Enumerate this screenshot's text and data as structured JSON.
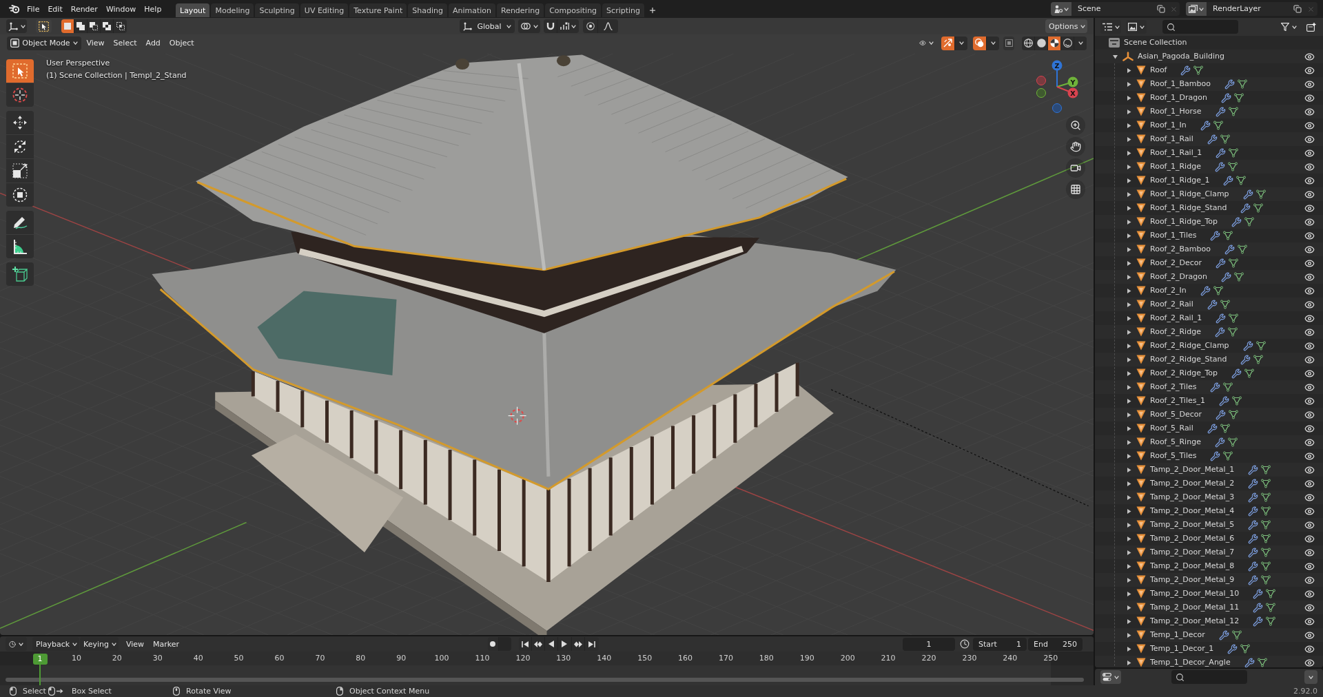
{
  "topbar": {
    "menus": [
      "File",
      "Edit",
      "Render",
      "Window",
      "Help"
    ],
    "workspaces": [
      {
        "label": "Layout",
        "selected": true
      },
      {
        "label": "Modeling",
        "selected": false
      },
      {
        "label": "Sculpting",
        "selected": false
      },
      {
        "label": "UV Editing",
        "selected": false
      },
      {
        "label": "Texture Paint",
        "selected": false
      },
      {
        "label": "Shading",
        "selected": false
      },
      {
        "label": "Animation",
        "selected": false
      },
      {
        "label": "Rendering",
        "selected": false
      },
      {
        "label": "Compositing",
        "selected": false
      },
      {
        "label": "Scripting",
        "selected": false
      }
    ],
    "scene": "Scene",
    "view_layer": "RenderLayer"
  },
  "tool_header": {
    "select_modes": [
      {
        "kind": "set",
        "selected": true
      },
      {
        "kind": "extend",
        "selected": false
      },
      {
        "kind": "subtract",
        "selected": false
      },
      {
        "kind": "difference",
        "selected": false
      },
      {
        "kind": "intersect",
        "selected": false
      }
    ],
    "orientation": "Global",
    "snap": false,
    "proportional_editing": false,
    "options": "Options"
  },
  "view3d_header": {
    "mode": "Object Mode",
    "menus": [
      "View",
      "Select",
      "Add",
      "Object"
    ],
    "gizmos": true,
    "overlays": true,
    "xray": false,
    "shading": [
      {
        "kind": "wireframe",
        "selected": false
      },
      {
        "kind": "solid",
        "selected": false
      },
      {
        "kind": "material",
        "selected": true
      },
      {
        "kind": "rendered",
        "selected": false
      }
    ]
  },
  "toolbar": {
    "groups": [
      {
        "tools": [
          {
            "kind": "select_box",
            "selected": true
          },
          {
            "kind": "cursor",
            "selected": false
          }
        ]
      },
      {
        "tools": [
          {
            "kind": "move",
            "selected": false
          },
          {
            "kind": "rotate",
            "selected": false
          },
          {
            "kind": "scale",
            "selected": false
          },
          {
            "kind": "transform",
            "selected": false
          }
        ]
      },
      {
        "tools": [
          {
            "kind": "annotate",
            "selected": false
          },
          {
            "kind": "measure",
            "selected": false
          }
        ]
      },
      {
        "tools": [
          {
            "kind": "add_cube",
            "selected": false
          }
        ]
      }
    ]
  },
  "viewport": {
    "info": [
      "User Perspective",
      "(1) Scene Collection | Templ_2_Stand"
    ],
    "gizmo_axes": [
      {
        "kind": "z",
        "label": "Z"
      },
      {
        "kind": "y",
        "label": "Y"
      },
      {
        "kind": "x",
        "label": "X"
      }
    ]
  },
  "outliner": {
    "tree": [
      {
        "name": "Scene Collection",
        "kind": "scene_collection",
        "children": [
          {
            "name": "Asian_Pagoda_Building",
            "kind": "empty",
            "expanded": true,
            "visible": true,
            "children": [
              {
                "name": "Roof",
                "kind": "mesh",
                "expanded": false,
                "visible": true
              },
              {
                "name": "Roof_1_Bamboo",
                "kind": "mesh",
                "expanded": false,
                "visible": true
              },
              {
                "name": "Roof_1_Dragon",
                "kind": "mesh",
                "expanded": false,
                "visible": true
              },
              {
                "name": "Roof_1_Horse",
                "kind": "mesh",
                "expanded": false,
                "visible": true
              },
              {
                "name": "Roof_1_In",
                "kind": "mesh",
                "expanded": false,
                "visible": true
              },
              {
                "name": "Roof_1_Rail",
                "kind": "mesh",
                "expanded": false,
                "visible": true
              },
              {
                "name": "Roof_1_Rail_1",
                "kind": "mesh",
                "expanded": false,
                "visible": true
              },
              {
                "name": "Roof_1_Ridge",
                "kind": "mesh",
                "expanded": false,
                "visible": true
              },
              {
                "name": "Roof_1_Ridge_1",
                "kind": "mesh",
                "expanded": false,
                "visible": true
              },
              {
                "name": "Roof_1_Ridge_Clamp",
                "kind": "mesh",
                "expanded": false,
                "visible": true
              },
              {
                "name": "Roof_1_Ridge_Stand",
                "kind": "mesh",
                "expanded": false,
                "visible": true
              },
              {
                "name": "Roof_1_Ridge_Top",
                "kind": "mesh",
                "expanded": false,
                "visible": true
              },
              {
                "name": "Roof_1_Tiles",
                "kind": "mesh",
                "expanded": false,
                "visible": true
              },
              {
                "name": "Roof_2_Bamboo",
                "kind": "mesh",
                "expanded": false,
                "visible": true
              },
              {
                "name": "Roof_2_Decor",
                "kind": "mesh",
                "expanded": false,
                "visible": true
              },
              {
                "name": "Roof_2_Dragon",
                "kind": "mesh",
                "expanded": false,
                "visible": true
              },
              {
                "name": "Roof_2_In",
                "kind": "mesh",
                "expanded": false,
                "visible": true
              },
              {
                "name": "Roof_2_Rail",
                "kind": "mesh",
                "expanded": false,
                "visible": true
              },
              {
                "name": "Roof_2_Rail_1",
                "kind": "mesh",
                "expanded": false,
                "visible": true
              },
              {
                "name": "Roof_2_Ridge",
                "kind": "mesh",
                "expanded": false,
                "visible": true
              },
              {
                "name": "Roof_2_Ridge_Clamp",
                "kind": "mesh",
                "expanded": false,
                "visible": true
              },
              {
                "name": "Roof_2_Ridge_Stand",
                "kind": "mesh",
                "expanded": false,
                "visible": true
              },
              {
                "name": "Roof_2_Ridge_Top",
                "kind": "mesh",
                "expanded": false,
                "visible": true
              },
              {
                "name": "Roof_2_Tiles",
                "kind": "mesh",
                "expanded": false,
                "visible": true
              },
              {
                "name": "Roof_2_Tiles_1",
                "kind": "mesh",
                "expanded": false,
                "visible": true
              },
              {
                "name": "Roof_5_Decor",
                "kind": "mesh",
                "expanded": false,
                "visible": true
              },
              {
                "name": "Roof_5_Rail",
                "kind": "mesh",
                "expanded": false,
                "visible": true
              },
              {
                "name": "Roof_5_Ringe",
                "kind": "mesh",
                "expanded": false,
                "visible": true
              },
              {
                "name": "Roof_5_Tiles",
                "kind": "mesh",
                "expanded": false,
                "visible": true
              },
              {
                "name": "Tamp_2_Door_Metal_1",
                "kind": "mesh",
                "expanded": false,
                "visible": true
              },
              {
                "name": "Tamp_2_Door_Metal_2",
                "kind": "mesh",
                "expanded": false,
                "visible": true
              },
              {
                "name": "Tamp_2_Door_Metal_3",
                "kind": "mesh",
                "expanded": false,
                "visible": true
              },
              {
                "name": "Tamp_2_Door_Metal_4",
                "kind": "mesh",
                "expanded": false,
                "visible": true
              },
              {
                "name": "Tamp_2_Door_Metal_5",
                "kind": "mesh",
                "expanded": false,
                "visible": true
              },
              {
                "name": "Tamp_2_Door_Metal_6",
                "kind": "mesh",
                "expanded": false,
                "visible": true
              },
              {
                "name": "Tamp_2_Door_Metal_7",
                "kind": "mesh",
                "expanded": false,
                "visible": true
              },
              {
                "name": "Tamp_2_Door_Metal_8",
                "kind": "mesh",
                "expanded": false,
                "visible": true
              },
              {
                "name": "Tamp_2_Door_Metal_9",
                "kind": "mesh",
                "expanded": false,
                "visible": true
              },
              {
                "name": "Tamp_2_Door_Metal_10",
                "kind": "mesh",
                "expanded": false,
                "visible": true
              },
              {
                "name": "Tamp_2_Door_Metal_11",
                "kind": "mesh",
                "expanded": false,
                "visible": true
              },
              {
                "name": "Tamp_2_Door_Metal_12",
                "kind": "mesh",
                "expanded": false,
                "visible": true
              },
              {
                "name": "Temp_1_Decor",
                "kind": "mesh",
                "expanded": false,
                "visible": true
              },
              {
                "name": "Temp_1_Decor_1",
                "kind": "mesh",
                "expanded": false,
                "visible": true
              },
              {
                "name": "Temp_1_Decor_Angle",
                "kind": "mesh",
                "expanded": false,
                "visible": true
              }
            ]
          }
        ]
      }
    ]
  },
  "timeline": {
    "menus": [
      {
        "label": "Playback",
        "kind": "dropdown"
      },
      {
        "label": "Keying",
        "kind": "dropdown"
      },
      {
        "label": "View",
        "kind": "menu"
      },
      {
        "label": "Marker",
        "kind": "menu"
      }
    ],
    "auto_keying": false,
    "current_frame": "1",
    "start": {
      "label": "Start",
      "value": "1"
    },
    "end": {
      "label": "End",
      "value": "250"
    },
    "playhead": "1",
    "ruler": [
      "10",
      "20",
      "30",
      "40",
      "50",
      "60",
      "70",
      "80",
      "90",
      "100",
      "110",
      "120",
      "130",
      "140",
      "150",
      "160",
      "170",
      "180",
      "190",
      "200",
      "210",
      "220",
      "230",
      "240",
      "250"
    ]
  },
  "status_bar": {
    "hints": [
      {
        "kind": "left_mouse",
        "label": "Select"
      },
      {
        "kind": "drag",
        "label": "Box Select"
      },
      {
        "kind": "middle_mouse",
        "label": "Rotate View"
      },
      {
        "kind": "right_mouse",
        "label": "Object Context Menu"
      }
    ],
    "version": "2.92.0"
  }
}
